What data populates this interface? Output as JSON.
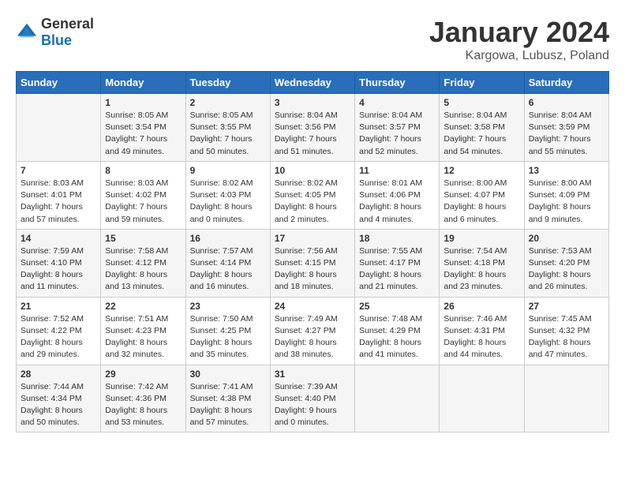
{
  "header": {
    "logo_general": "General",
    "logo_blue": "Blue",
    "month_year": "January 2024",
    "location": "Kargowa, Lubusz, Poland"
  },
  "days_of_week": [
    "Sunday",
    "Monday",
    "Tuesday",
    "Wednesday",
    "Thursday",
    "Friday",
    "Saturday"
  ],
  "weeks": [
    [
      {
        "day": "",
        "info": ""
      },
      {
        "day": "1",
        "info": "Sunrise: 8:05 AM\nSunset: 3:54 PM\nDaylight: 7 hours\nand 49 minutes."
      },
      {
        "day": "2",
        "info": "Sunrise: 8:05 AM\nSunset: 3:55 PM\nDaylight: 7 hours\nand 50 minutes."
      },
      {
        "day": "3",
        "info": "Sunrise: 8:04 AM\nSunset: 3:56 PM\nDaylight: 7 hours\nand 51 minutes."
      },
      {
        "day": "4",
        "info": "Sunrise: 8:04 AM\nSunset: 3:57 PM\nDaylight: 7 hours\nand 52 minutes."
      },
      {
        "day": "5",
        "info": "Sunrise: 8:04 AM\nSunset: 3:58 PM\nDaylight: 7 hours\nand 54 minutes."
      },
      {
        "day": "6",
        "info": "Sunrise: 8:04 AM\nSunset: 3:59 PM\nDaylight: 7 hours\nand 55 minutes."
      }
    ],
    [
      {
        "day": "7",
        "info": "Sunrise: 8:03 AM\nSunset: 4:01 PM\nDaylight: 7 hours\nand 57 minutes."
      },
      {
        "day": "8",
        "info": "Sunrise: 8:03 AM\nSunset: 4:02 PM\nDaylight: 7 hours\nand 59 minutes."
      },
      {
        "day": "9",
        "info": "Sunrise: 8:02 AM\nSunset: 4:03 PM\nDaylight: 8 hours\nand 0 minutes."
      },
      {
        "day": "10",
        "info": "Sunrise: 8:02 AM\nSunset: 4:05 PM\nDaylight: 8 hours\nand 2 minutes."
      },
      {
        "day": "11",
        "info": "Sunrise: 8:01 AM\nSunset: 4:06 PM\nDaylight: 8 hours\nand 4 minutes."
      },
      {
        "day": "12",
        "info": "Sunrise: 8:00 AM\nSunset: 4:07 PM\nDaylight: 8 hours\nand 6 minutes."
      },
      {
        "day": "13",
        "info": "Sunrise: 8:00 AM\nSunset: 4:09 PM\nDaylight: 8 hours\nand 9 minutes."
      }
    ],
    [
      {
        "day": "14",
        "info": "Sunrise: 7:59 AM\nSunset: 4:10 PM\nDaylight: 8 hours\nand 11 minutes."
      },
      {
        "day": "15",
        "info": "Sunrise: 7:58 AM\nSunset: 4:12 PM\nDaylight: 8 hours\nand 13 minutes."
      },
      {
        "day": "16",
        "info": "Sunrise: 7:57 AM\nSunset: 4:14 PM\nDaylight: 8 hours\nand 16 minutes."
      },
      {
        "day": "17",
        "info": "Sunrise: 7:56 AM\nSunset: 4:15 PM\nDaylight: 8 hours\nand 18 minutes."
      },
      {
        "day": "18",
        "info": "Sunrise: 7:55 AM\nSunset: 4:17 PM\nDaylight: 8 hours\nand 21 minutes."
      },
      {
        "day": "19",
        "info": "Sunrise: 7:54 AM\nSunset: 4:18 PM\nDaylight: 8 hours\nand 23 minutes."
      },
      {
        "day": "20",
        "info": "Sunrise: 7:53 AM\nSunset: 4:20 PM\nDaylight: 8 hours\nand 26 minutes."
      }
    ],
    [
      {
        "day": "21",
        "info": "Sunrise: 7:52 AM\nSunset: 4:22 PM\nDaylight: 8 hours\nand 29 minutes."
      },
      {
        "day": "22",
        "info": "Sunrise: 7:51 AM\nSunset: 4:23 PM\nDaylight: 8 hours\nand 32 minutes."
      },
      {
        "day": "23",
        "info": "Sunrise: 7:50 AM\nSunset: 4:25 PM\nDaylight: 8 hours\nand 35 minutes."
      },
      {
        "day": "24",
        "info": "Sunrise: 7:49 AM\nSunset: 4:27 PM\nDaylight: 8 hours\nand 38 minutes."
      },
      {
        "day": "25",
        "info": "Sunrise: 7:48 AM\nSunset: 4:29 PM\nDaylight: 8 hours\nand 41 minutes."
      },
      {
        "day": "26",
        "info": "Sunrise: 7:46 AM\nSunset: 4:31 PM\nDaylight: 8 hours\nand 44 minutes."
      },
      {
        "day": "27",
        "info": "Sunrise: 7:45 AM\nSunset: 4:32 PM\nDaylight: 8 hours\nand 47 minutes."
      }
    ],
    [
      {
        "day": "28",
        "info": "Sunrise: 7:44 AM\nSunset: 4:34 PM\nDaylight: 8 hours\nand 50 minutes."
      },
      {
        "day": "29",
        "info": "Sunrise: 7:42 AM\nSunset: 4:36 PM\nDaylight: 8 hours\nand 53 minutes."
      },
      {
        "day": "30",
        "info": "Sunrise: 7:41 AM\nSunset: 4:38 PM\nDaylight: 8 hours\nand 57 minutes."
      },
      {
        "day": "31",
        "info": "Sunrise: 7:39 AM\nSunset: 4:40 PM\nDaylight: 9 hours\nand 0 minutes."
      },
      {
        "day": "",
        "info": ""
      },
      {
        "day": "",
        "info": ""
      },
      {
        "day": "",
        "info": ""
      }
    ]
  ]
}
